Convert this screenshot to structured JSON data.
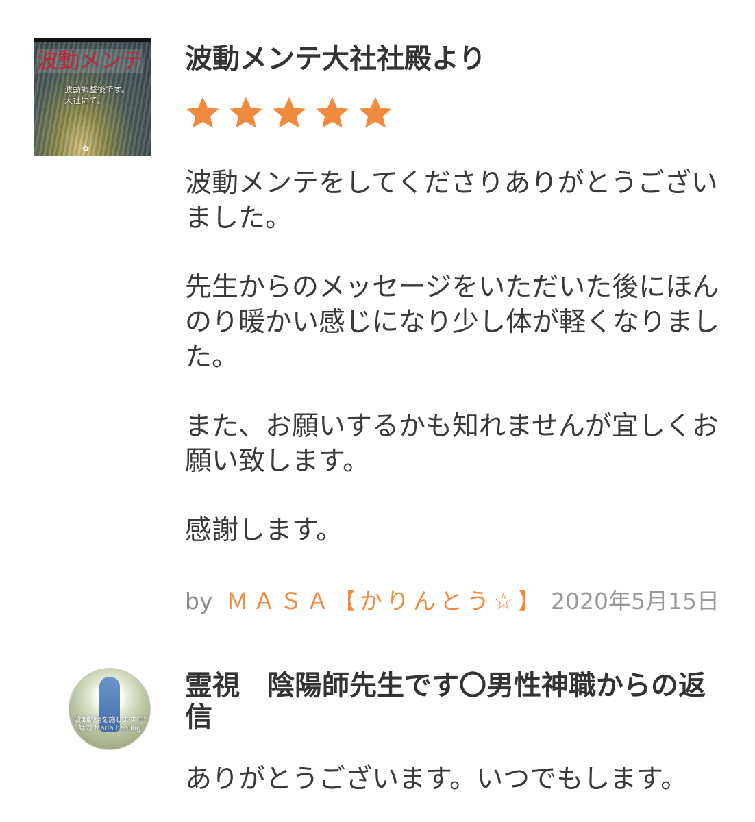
{
  "review": {
    "thumbnail": {
      "title": "波動メンテ",
      "subtitle": "波動調整後です。大社にて。",
      "mark": "✿"
    },
    "title": "波動メンテ大社社殿より",
    "rating": 5,
    "rating_max": 5,
    "star_color": "#f08a3e",
    "paragraphs": [
      "波動メンテをしてくださりありがとうございました。",
      "先生からのメッセージをいただいた後にほんのり暖かい感じになり少し体が軽くなりました。",
      "また、お願いするかも知れませんが宜しくお願い致します。",
      "感謝します。"
    ],
    "by_label": "by",
    "author": "ＭＡＳＡ【かりんとう☆】",
    "date": "2020年5月15日"
  },
  "reply": {
    "avatar_text": "波動調整を施します 守護力 Maria healing",
    "title": "霊視　陰陽師先生です〇男性神職からの返信",
    "body": "ありがとうございます。いつでもします。"
  },
  "colors": {
    "accent": "#f08a3e",
    "text": "#333333",
    "muted": "#9a9a9a"
  }
}
